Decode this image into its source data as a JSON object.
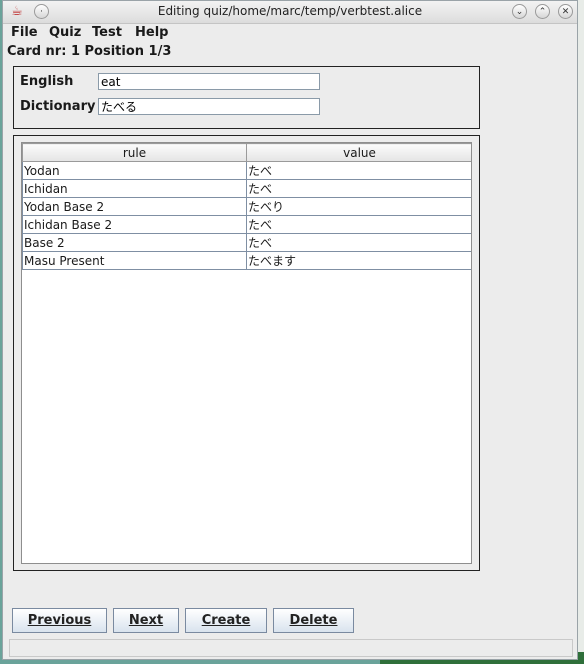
{
  "window": {
    "title": "Editing quiz/home/marc/temp/verbtest.alice"
  },
  "menu": {
    "items": [
      "File",
      "Quiz",
      "Test",
      "Help"
    ]
  },
  "card_info": "Card nr: 1 Position 1/3",
  "form": {
    "english_label": "English",
    "english_value": "eat",
    "dictionary_label": "Dictionary",
    "dictionary_value": "たべる"
  },
  "table": {
    "headers": [
      "rule",
      "value"
    ],
    "rows": [
      [
        "Yodan",
        "たべ"
      ],
      [
        "Ichidan",
        "たべ"
      ],
      [
        "Yodan Base 2",
        "たべり"
      ],
      [
        "Ichidan Base 2",
        "たべ"
      ],
      [
        "Base 2",
        "たべ"
      ],
      [
        "Masu Present",
        "たべます"
      ]
    ]
  },
  "buttons": {
    "previous": "Previous",
    "next": "Next",
    "create": "Create",
    "delete": "Delete"
  }
}
